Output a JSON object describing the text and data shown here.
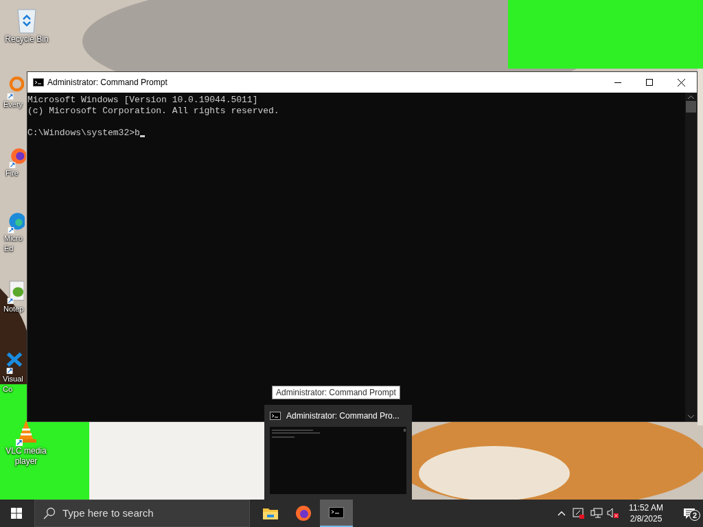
{
  "desktop_icons": [
    {
      "kind": "recycle-bin",
      "lines": [
        "Recycle Bin"
      ]
    },
    {
      "kind": "search-app",
      "lines": [
        "Every"
      ]
    },
    {
      "kind": "browser-fox",
      "lines": [
        "Fire"
      ]
    },
    {
      "kind": "browser-wave",
      "lines": [
        "Micro",
        "Ed"
      ]
    },
    {
      "kind": "notepad",
      "lines": [
        "Notep"
      ]
    },
    {
      "kind": "code-editor",
      "lines": [
        "Visual",
        "Co"
      ]
    },
    {
      "kind": "cone",
      "lines": [
        "VLC media",
        "player"
      ]
    }
  ],
  "window": {
    "title": "Administrator: Command Prompt",
    "lines": [
      {
        "kind": "output",
        "text": "Microsoft Windows [Version 10.0.19044.5011]"
      },
      {
        "kind": "output",
        "text": "(c) Microsoft Corporation. All rights reserved."
      },
      {
        "kind": "prompt",
        "text": "C:\\Windows\\system32>b"
      }
    ]
  },
  "tooltip": "Administrator: Command Prompt",
  "thumbnail": {
    "title": "Administrator: Command Pro..."
  },
  "taskbar": {
    "search": {
      "placeholder": "Type here to search"
    },
    "apps": [
      {
        "kind": "folder",
        "selected": false
      },
      {
        "kind": "browser-fox",
        "selected": false
      },
      {
        "kind": "terminal",
        "selected": true
      }
    ],
    "time": "11:52 AM",
    "date": "2/8/2025",
    "notifications": "2"
  }
}
